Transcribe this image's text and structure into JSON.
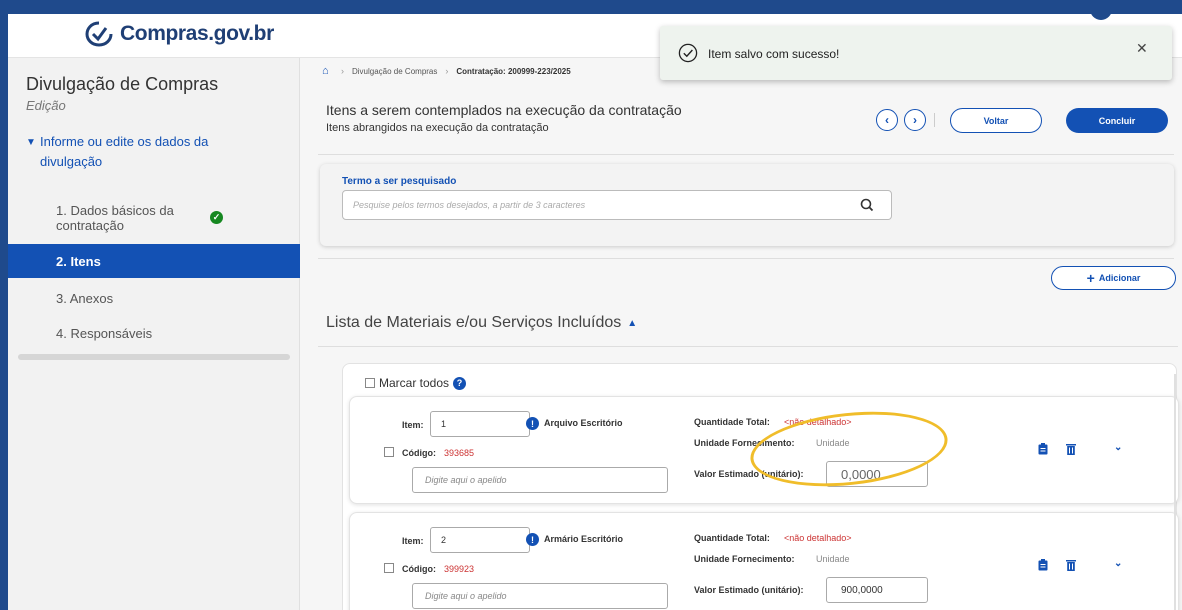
{
  "header": {
    "logo_text": "Compras.gov.br"
  },
  "toast": {
    "message": "Item salvo com sucesso!",
    "close_glyph": "✕"
  },
  "sidebar": {
    "title": "Divulgação de Compras",
    "subtitle": "Edição",
    "section_label": "Informe ou edite os dados da divulgação",
    "items": [
      {
        "label": "1.  Dados básicos da contratação",
        "active": false,
        "completed": true
      },
      {
        "label": "2.  Itens",
        "active": true,
        "completed": false
      },
      {
        "label": "3.  Anexos",
        "active": false,
        "completed": false
      },
      {
        "label": "4.  Responsáveis",
        "active": false,
        "completed": false
      }
    ]
  },
  "breadcrumb": [
    {
      "label": "Divulgação de Compras"
    },
    {
      "label": "Contratação: 200999-223/2025"
    }
  ],
  "page": {
    "title": "Itens a serem contemplados na execução da contratação",
    "subtitle": "Itens abrangidos na execução da contratação",
    "prev_glyph": "‹",
    "next_glyph": "›",
    "back_label": "Voltar",
    "finish_label": "Concluir"
  },
  "search": {
    "label": "Termo a ser pesquisado",
    "placeholder": "Pesquise pelos termos desejados, a partir de 3 caracteres",
    "value": ""
  },
  "add_label": "Adicionar",
  "list": {
    "title": "Lista de Materiais e/ou Serviços Incluídos",
    "mark_all_label": "Marcar todos",
    "item_label": "Item:",
    "code_label": "Código:",
    "qty_label": "Quantidade Total:",
    "unit_label": "Unidade Fornecimento:",
    "value_label": "Valor Estimado (unitário):",
    "alias_placeholder": "Digite aqui o apelido",
    "items": [
      {
        "number": "1",
        "description": "Arquivo Escritório",
        "code": "393685",
        "quantity": "<não detalhado>",
        "unit": "Unidade",
        "estimated_value": "0,0000"
      },
      {
        "number": "2",
        "description": "Armário Escritório",
        "code": "399923",
        "quantity": "<não detalhado>",
        "unit": "Unidade",
        "estimated_value": "900,0000"
      }
    ]
  },
  "colors": {
    "primary": "#1351b4",
    "success": "#168821",
    "danger": "#cc3333",
    "highlight": "#f0bd2a",
    "frame": "#1f4a8c"
  }
}
